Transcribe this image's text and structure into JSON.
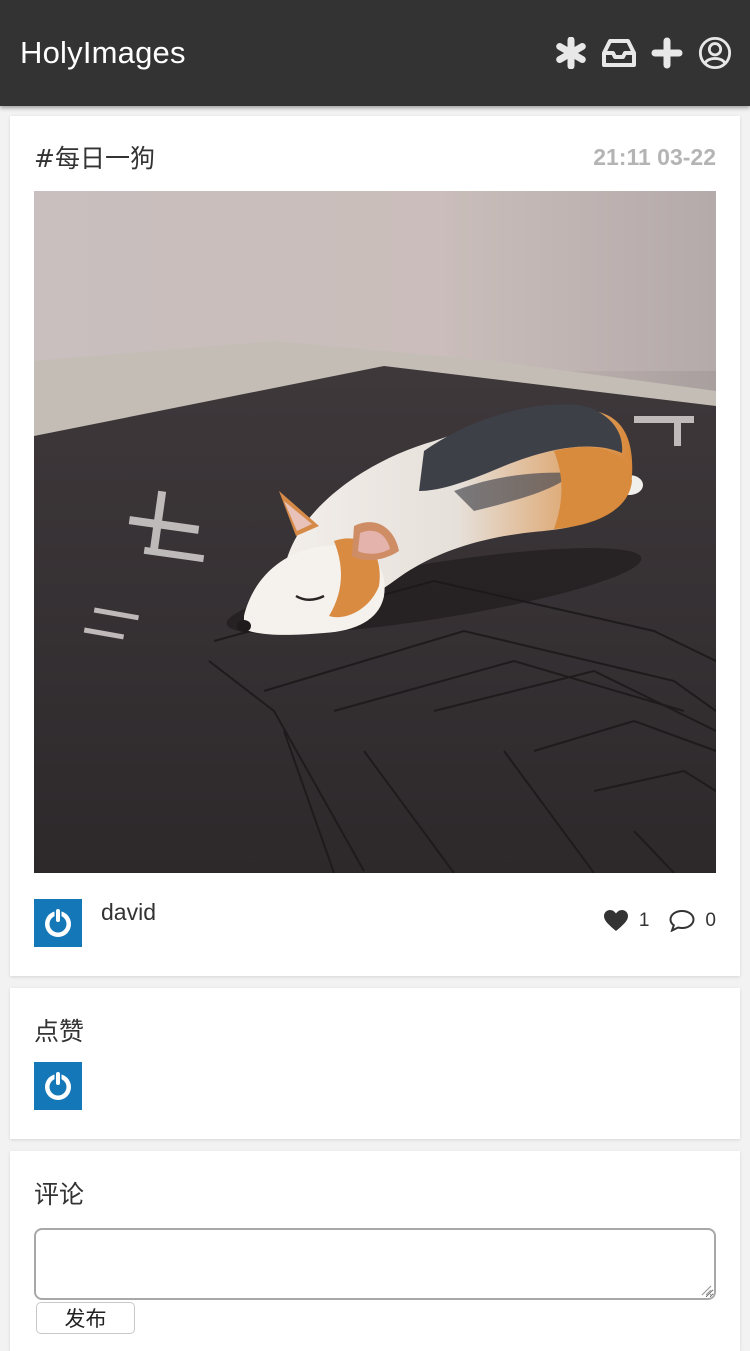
{
  "app": {
    "brand": "HolyImages"
  },
  "nav": {
    "icons": [
      "asterisk-icon",
      "inbox-icon",
      "plus-icon",
      "user-circle-icon"
    ]
  },
  "post": {
    "tag": "#每日一狗",
    "timestamp": "21:11 03-22",
    "photo": "sleeping-corgi-figurine",
    "author": "david",
    "likes_count": "1",
    "comments_count": "0"
  },
  "likes_section": {
    "title": "点赞"
  },
  "comments_section": {
    "title": "评论",
    "input_value": "",
    "submit_label": "发布"
  },
  "colors": {
    "navbar": "#333333",
    "avatar_bg": "#1478b8",
    "timestamp": "#b4b4b4",
    "page_bg": "#f2f2f2"
  }
}
